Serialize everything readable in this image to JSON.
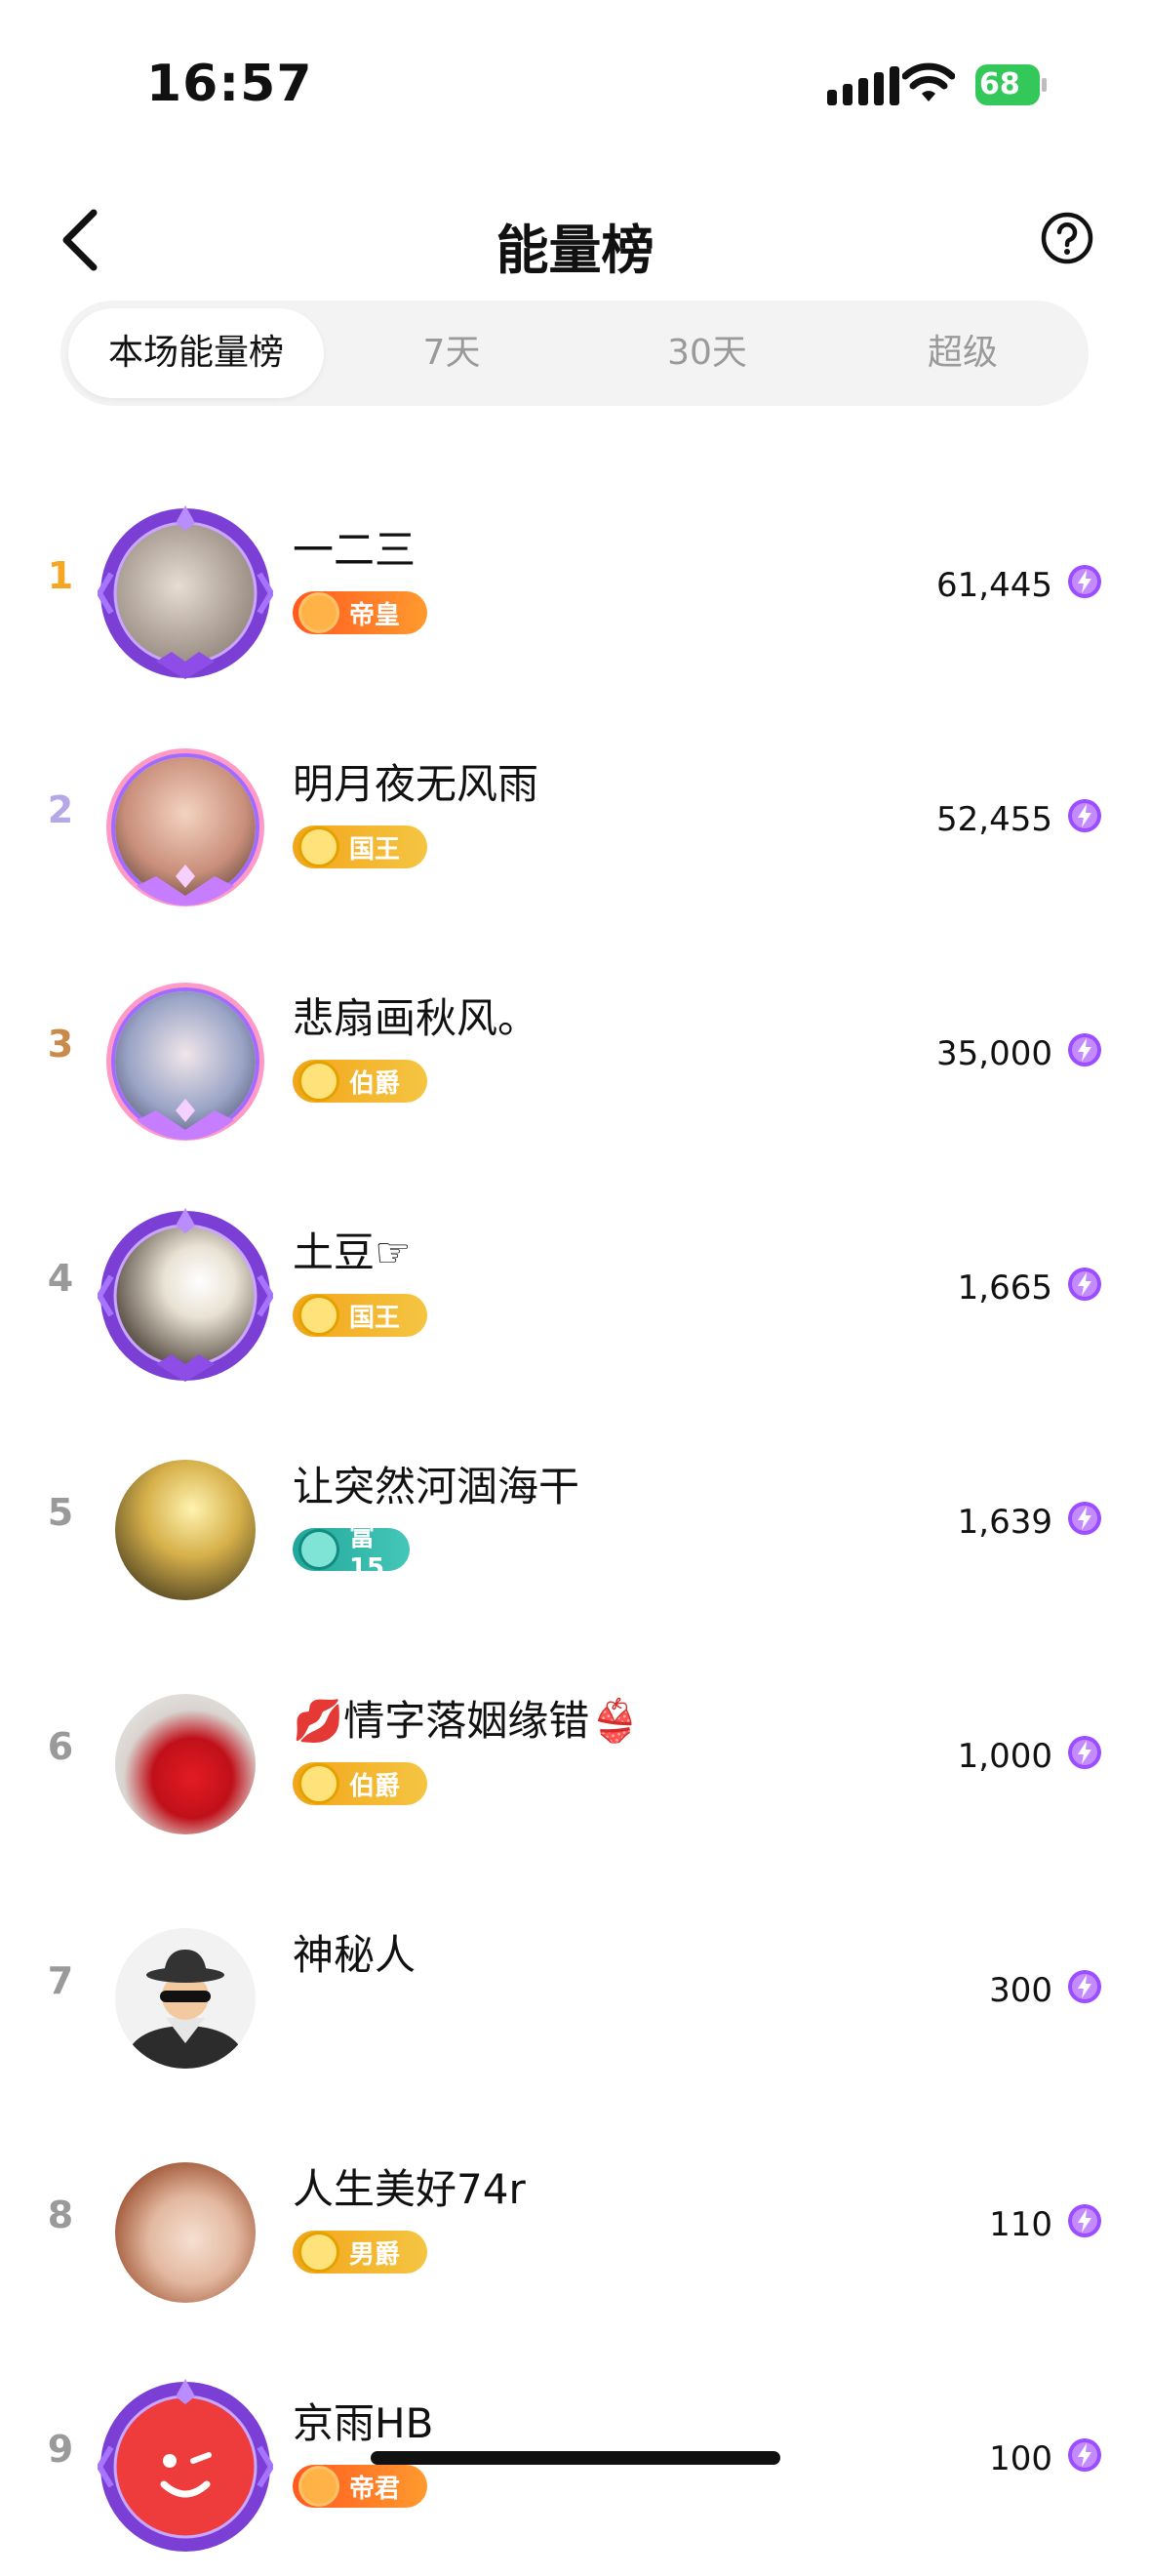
{
  "status": {
    "time": "16:57",
    "battery": "68"
  },
  "header": {
    "title": "能量榜"
  },
  "tabs": [
    "本场能量榜",
    "7天",
    "30天",
    "超级"
  ],
  "rows": [
    {
      "rank": "1",
      "name": "一二三",
      "badge": "帝皇",
      "score": "61,445"
    },
    {
      "rank": "2",
      "name": "明月夜无风雨",
      "badge": "国王",
      "score": "52,455"
    },
    {
      "rank": "3",
      "name": "悲扇画秋风。",
      "badge": "伯爵",
      "score": "35,000"
    },
    {
      "rank": "4",
      "name": "土豆☞",
      "badge": "国王",
      "score": "1,665"
    },
    {
      "rank": "5",
      "name": "让突然河涸海干",
      "badge": "富15",
      "score": "1,639"
    },
    {
      "rank": "6",
      "name": "💋情字落姻缘错👙",
      "badge": "伯爵",
      "score": "1,000"
    },
    {
      "rank": "7",
      "name": "神秘人",
      "badge": "",
      "score": "300"
    },
    {
      "rank": "8",
      "name": "人生美好74r",
      "badge": "男爵",
      "score": "110"
    },
    {
      "rank": "9",
      "name": "京雨HB",
      "badge": "帝君",
      "score": "100"
    }
  ],
  "colors": {
    "rank1": "#f5a623",
    "rank2": "#b6a7e6",
    "rank3": "#c98a4a",
    "rankOther": "#9a9a9a",
    "badgeOrange": "#ff7a1a",
    "badgeGold": "#f2b62a",
    "badgeTeal": "#2cb3a6",
    "bolt": "#9b4dff"
  }
}
